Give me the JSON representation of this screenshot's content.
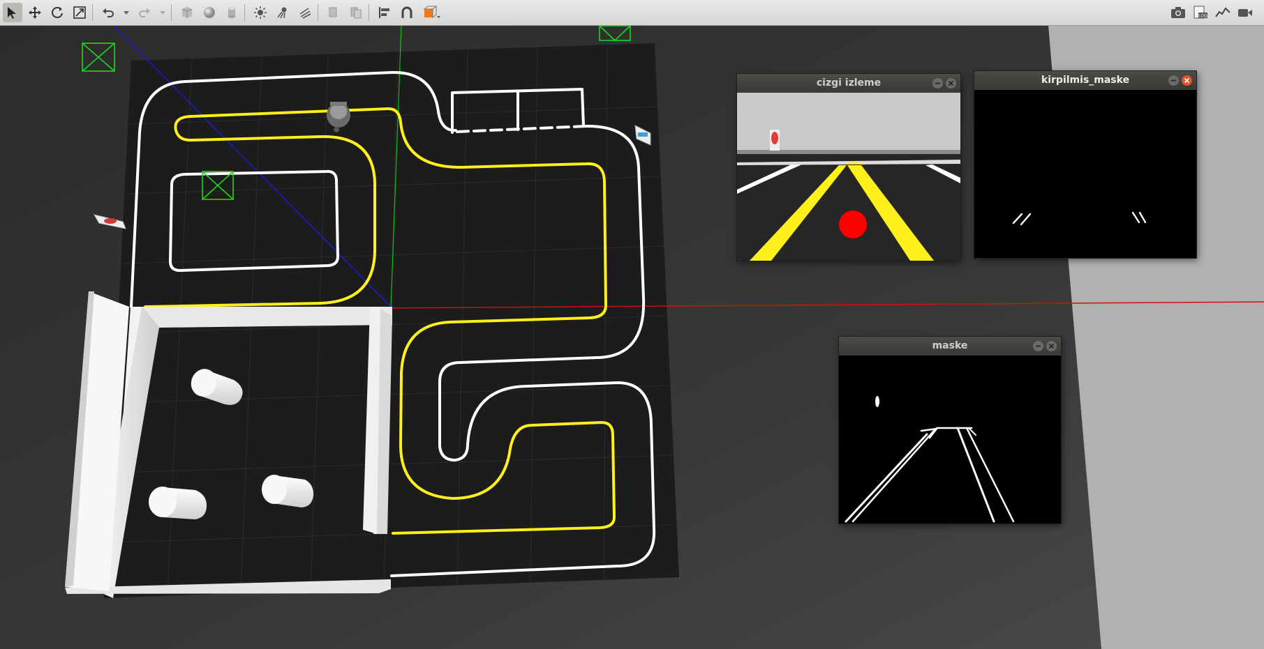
{
  "toolbar": {
    "left_tools": [
      {
        "name": "select-mode-icon",
        "active": true
      },
      {
        "name": "translate-mode-icon"
      },
      {
        "name": "rotate-mode-icon"
      },
      {
        "name": "scale-mode-icon"
      },
      {
        "name": "undo-icon"
      },
      {
        "name": "undo-dropdown-icon"
      },
      {
        "name": "redo-icon"
      },
      {
        "name": "redo-dropdown-icon"
      },
      {
        "name": "box-shape-icon"
      },
      {
        "name": "sphere-shape-icon"
      },
      {
        "name": "cylinder-shape-icon"
      },
      {
        "name": "point-light-icon"
      },
      {
        "name": "spot-light-icon"
      },
      {
        "name": "directional-light-icon"
      },
      {
        "name": "copy-icon"
      },
      {
        "name": "paste-icon"
      },
      {
        "name": "align-icon"
      },
      {
        "name": "snap-icon"
      },
      {
        "name": "view-angle-icon"
      }
    ],
    "right_tools": [
      {
        "name": "screenshot-icon"
      },
      {
        "name": "log-icon"
      },
      {
        "name": "plot-icon"
      },
      {
        "name": "video-record-icon"
      }
    ]
  },
  "windows": {
    "cizgi": {
      "title": "cizgi izleme"
    },
    "kirpilmis": {
      "title": "kirpilmis_maske"
    },
    "maske": {
      "title": "maske"
    }
  },
  "colors": {
    "lane_yellow": "#ffef1a",
    "lane_white": "#ffffff",
    "track_floor": "#1c1c1c",
    "axis_red": "#d01010",
    "axis_green": "#12c012",
    "axis_blue": "#1a1ad8",
    "marker_red": "#ff0000",
    "close_button": "#e5532b"
  }
}
